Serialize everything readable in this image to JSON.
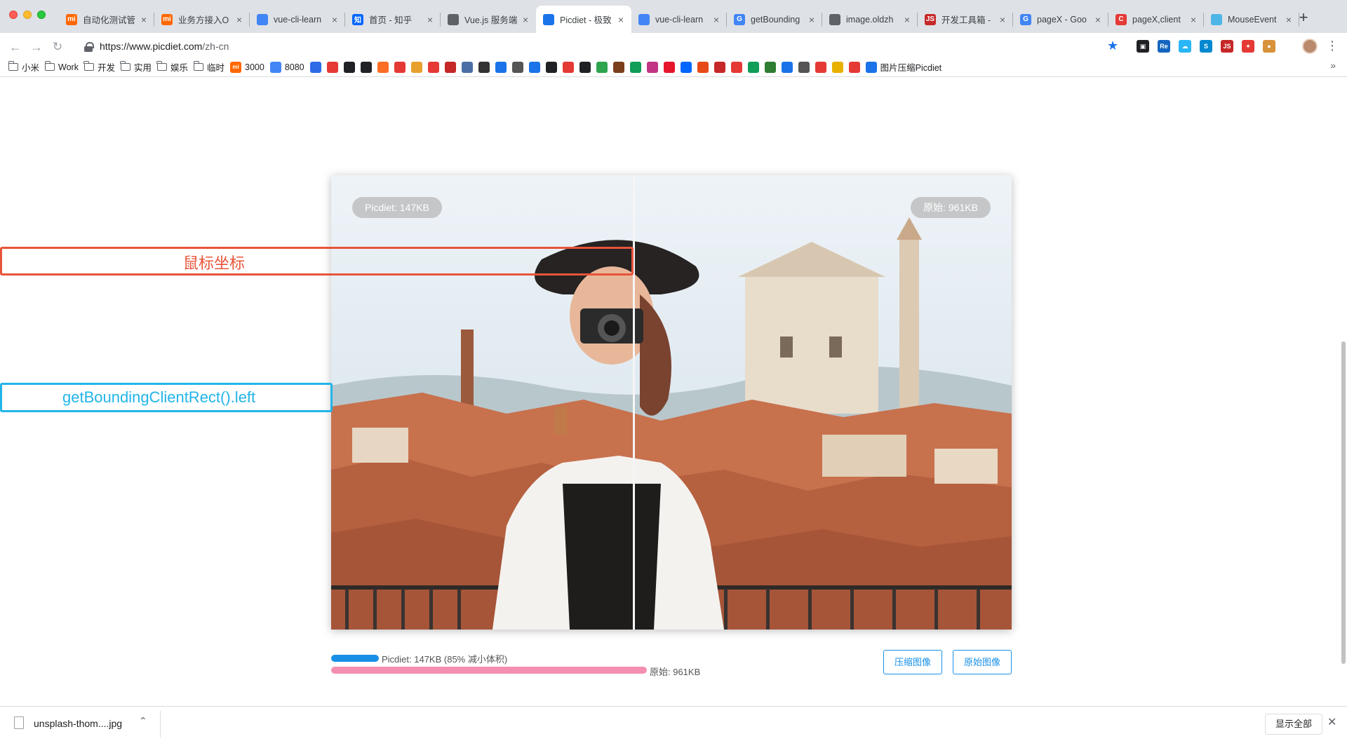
{
  "browser": {
    "tabs": [
      {
        "title": "自动化测试管",
        "icon": "xiaomi-icon",
        "icon_text": "mi",
        "color": "#ff6700",
        "active": false
      },
      {
        "title": "业务方接入O",
        "icon": "xiaomi-icon",
        "icon_text": "mi",
        "color": "#ff6700",
        "active": false
      },
      {
        "title": "vue-cli-learn",
        "icon": "chrome-icon",
        "icon_text": "",
        "color": "#4285f4",
        "active": false
      },
      {
        "title": "首页 - 知乎",
        "icon": "zhihu-icon",
        "icon_text": "知",
        "color": "#0066ff",
        "active": false
      },
      {
        "title": "Vue.js 服务端",
        "icon": "globe-icon",
        "icon_text": "",
        "color": "#5f6368",
        "active": false
      },
      {
        "title": "Picdiet - 极致",
        "icon": "picdiet-icon",
        "icon_text": "",
        "color": "#1a73e8",
        "active": true
      },
      {
        "title": "vue-cli-learn",
        "icon": "chrome-icon",
        "icon_text": "",
        "color": "#4285f4",
        "active": false
      },
      {
        "title": "getBounding",
        "icon": "google-icon",
        "icon_text": "G",
        "color": "#4285f4",
        "active": false
      },
      {
        "title": "image.oldzh",
        "icon": "globe-icon",
        "icon_text": "",
        "color": "#5f6368",
        "active": false
      },
      {
        "title": "开发工具箱 -",
        "icon": "toolbox-icon",
        "icon_text": "JS",
        "color": "#c62828",
        "active": false
      },
      {
        "title": "pageX - Goo",
        "icon": "google-icon",
        "icon_text": "G",
        "color": "#4285f4",
        "active": false
      },
      {
        "title": "pageX,client",
        "icon": "csdn-icon",
        "icon_text": "C",
        "color": "#e53935",
        "active": false
      },
      {
        "title": "MouseEvent",
        "icon": "mdn-icon",
        "icon_text": "",
        "color": "#4db6e6",
        "active": false
      }
    ],
    "address": {
      "host": "https://www.picdiet.com",
      "path": "/zh-cn"
    },
    "bookmarks": [
      {
        "label": "小米",
        "type": "folder"
      },
      {
        "label": "Work",
        "type": "folder"
      },
      {
        "label": "开发",
        "type": "folder"
      },
      {
        "label": "实用",
        "type": "folder"
      },
      {
        "label": "娱乐",
        "type": "folder"
      },
      {
        "label": "临时",
        "type": "folder"
      },
      {
        "label": "3000",
        "type": "site",
        "icon_text": "mi",
        "color": "#ff6700"
      },
      {
        "label": "8080",
        "type": "site",
        "icon_text": "",
        "color": "#4285f4"
      }
    ],
    "bookmark_icon_colors": [
      "#2f6ae6",
      "#e53935",
      "#202124",
      "#202124",
      "#fc6d26",
      "#e53935",
      "#e8a02f",
      "#e53935",
      "#c62828",
      "#4a6fa5",
      "#333",
      "#1a73e8",
      "#555",
      "#1a73e8",
      "#202124",
      "#e53935",
      "#202124",
      "#2ea44f",
      "#7a3e1d",
      "#0f9d58",
      "#c13584",
      "#e6162d",
      "#0066ff",
      "#e64a19",
      "#c62828",
      "#e53935",
      "#0f9d58",
      "#2e7d32",
      "#1a73e8",
      "#555",
      "#e53935",
      "#e8b000",
      "#e53935"
    ],
    "bookmark_last": "图片压缩Picdiet"
  },
  "page": {
    "compressed_pill": "Picdiet: 147KB",
    "original_pill": "原始: 961KB",
    "annotation_mouse": "鼠标坐标",
    "annotation_rect": "getBoundingClientRect().left",
    "compressed_label": "Picdiet: 147KB (85% 减小体积)",
    "original_label": "原始: 961KB",
    "compressed_ratio": 0.15,
    "compress_button": "压缩图像",
    "original_button": "原始图像",
    "divider_position": 0.445
  },
  "download": {
    "file_name": "unsplash-thom....jpg",
    "show_all": "显示全部"
  }
}
